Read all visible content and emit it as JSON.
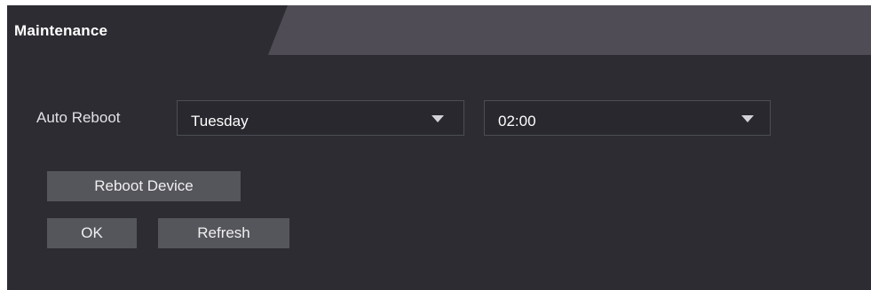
{
  "header": {
    "title": "Maintenance"
  },
  "form": {
    "auto_reboot_label": "Auto Reboot",
    "day_select": {
      "value": "Tuesday",
      "icon": "chevron-down-icon"
    },
    "time_select": {
      "value": "02:00",
      "icon": "chevron-down-icon"
    }
  },
  "buttons": {
    "reboot_device": "Reboot Device",
    "ok": "OK",
    "refresh": "Refresh"
  },
  "colors": {
    "panel_background": "#2c2c32",
    "header_bar": "#4f4c55",
    "button_background": "#55555c"
  }
}
